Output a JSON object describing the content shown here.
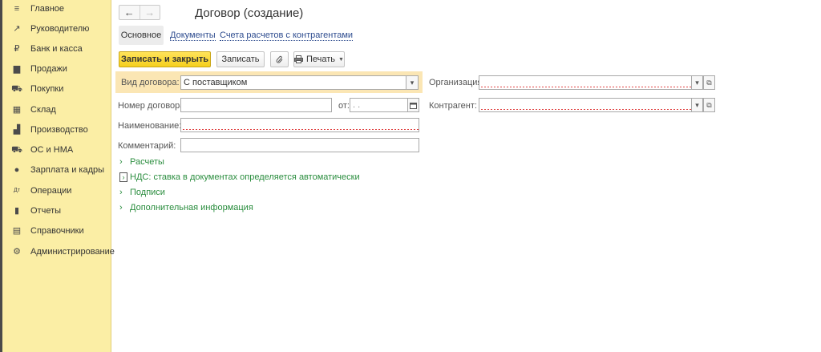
{
  "sidebar": {
    "items": [
      {
        "label": "Главное",
        "icon": "menu-icon"
      },
      {
        "label": "Руководителю",
        "icon": "trend-icon"
      },
      {
        "label": "Банк и касса",
        "icon": "ruble-icon"
      },
      {
        "label": "Продажи",
        "icon": "bag-icon"
      },
      {
        "label": "Покупки",
        "icon": "cart-icon"
      },
      {
        "label": "Склад",
        "icon": "warehouse-icon"
      },
      {
        "label": "Производство",
        "icon": "factory-icon"
      },
      {
        "label": "ОС и НМА",
        "icon": "truck-icon"
      },
      {
        "label": "Зарплата и кадры",
        "icon": "person-icon"
      },
      {
        "label": "Операции",
        "icon": "dt-kt-icon"
      },
      {
        "label": "Отчеты",
        "icon": "bar-chart-icon"
      },
      {
        "label": "Справочники",
        "icon": "books-icon"
      },
      {
        "label": "Администрирование",
        "icon": "gear-icon"
      }
    ],
    "icon_glyphs": [
      "≡",
      "↗",
      "₽",
      "▆",
      "⛟",
      "▦",
      "▟",
      "⛟",
      "●",
      "Дт",
      "▮",
      "▤",
      "⚙"
    ]
  },
  "header": {
    "back": "←",
    "forward": "→",
    "title": "Договор (создание)"
  },
  "tabs": {
    "main": "Основное",
    "documents": "Документы",
    "accounts": "Счета расчетов с контрагентами"
  },
  "toolbar": {
    "save_close": "Записать и закрыть",
    "save": "Записать",
    "attach_icon": "paperclip-icon",
    "print": "Печать"
  },
  "form": {
    "contract_type_label": "Вид договора:",
    "contract_type_value": "С поставщиком",
    "organization_label": "Организация:",
    "organization_value": "",
    "number_label": "Номер договора:",
    "number_value": "",
    "date_label": "от:",
    "date_value": " .  .",
    "counterparty_label": "Контрагент:",
    "counterparty_value": "",
    "name_label": "Наименование:",
    "name_value": "",
    "comment_label": "Комментарий:",
    "comment_value": ""
  },
  "groups": {
    "settlements": "Расчеты",
    "vat": "НДС: ставка в документах определяется автоматически",
    "signatures": "Подписи",
    "additional": "Дополнительная информация"
  },
  "colors": {
    "sidebar_bg": "#fbeea5",
    "primary_button": "#f5cf1d",
    "link": "#2e4c8f",
    "group_text": "#2a8d3e",
    "required_underline": "#e04040",
    "highlight": "#fbe6b4"
  }
}
